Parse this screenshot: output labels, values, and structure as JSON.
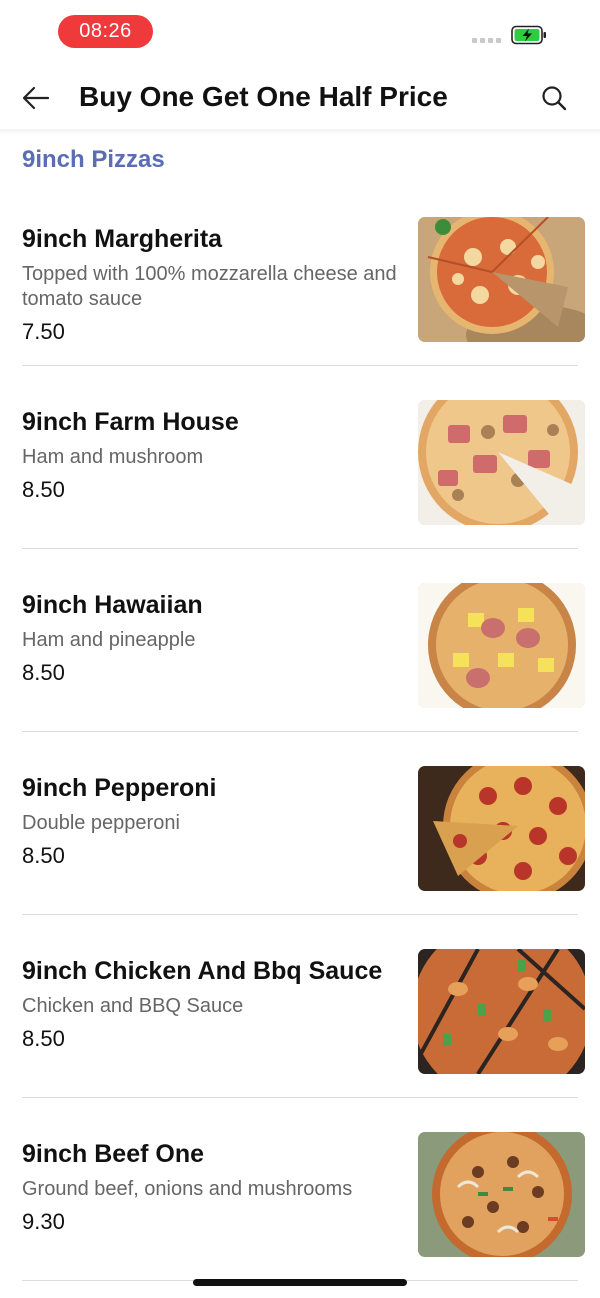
{
  "status_bar": {
    "time": "08:26"
  },
  "header": {
    "title": "Buy One Get One Half Price"
  },
  "section": {
    "title": "9inch Pizzas"
  },
  "items": [
    {
      "name": "9inch Margherita",
      "description": "Topped with 100% mozzarella cheese and tomato sauce",
      "price": "7.50"
    },
    {
      "name": "9inch Farm House",
      "description": "Ham and mushroom",
      "price": "8.50"
    },
    {
      "name": "9inch Hawaiian",
      "description": "Ham and pineapple",
      "price": "8.50"
    },
    {
      "name": "9inch Pepperoni",
      "description": "Double pepperoni",
      "price": "8.50"
    },
    {
      "name": "9inch Chicken And Bbq Sauce",
      "description": "Chicken and BBQ Sauce",
      "price": "8.50"
    },
    {
      "name": "9inch Beef One",
      "description": "Ground beef, onions and mushrooms",
      "price": "9.30"
    }
  ],
  "colors": {
    "accent": "#5b6db5",
    "time_pill": "#f0393a",
    "battery": "#2ecc40"
  }
}
